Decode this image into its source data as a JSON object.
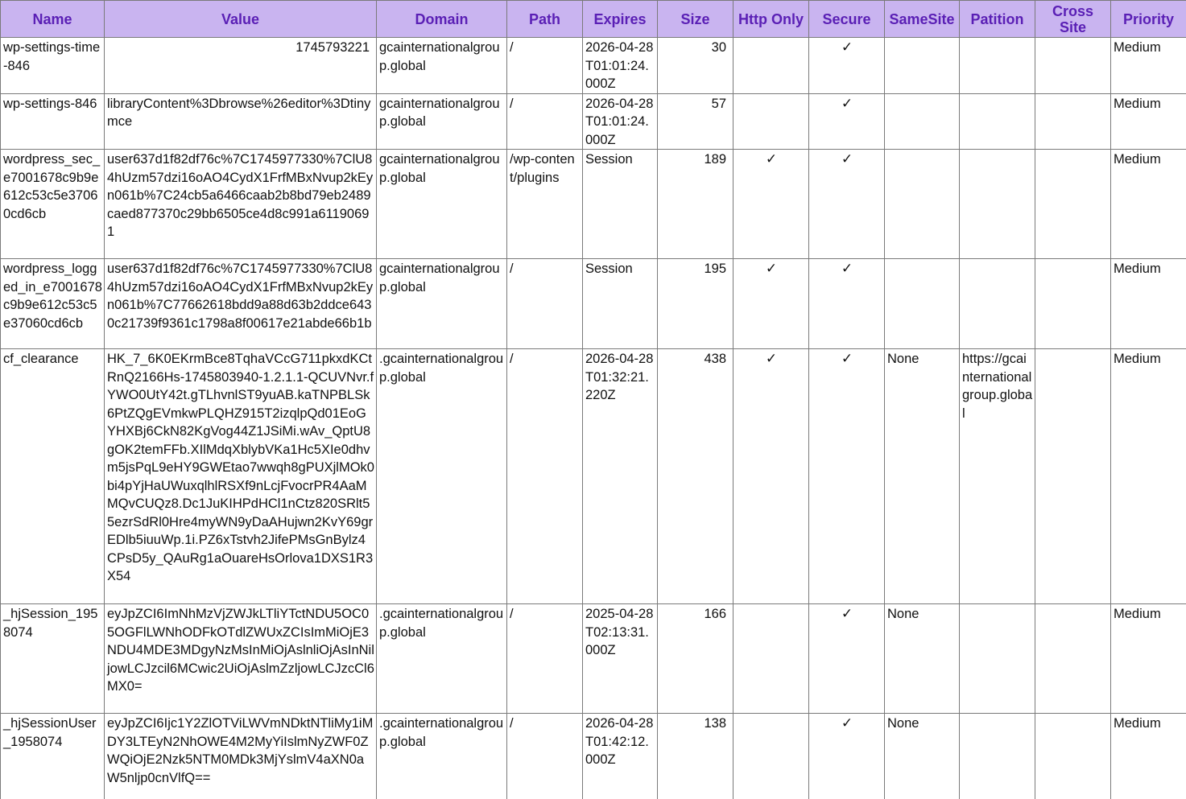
{
  "headers": {
    "name": "Name",
    "value": "Value",
    "domain": "Domain",
    "path": "Path",
    "expires": "Expires",
    "size": "Size",
    "http_only": "Http Only",
    "secure": "Secure",
    "same_site": "SameSite",
    "partition": "Patition",
    "cross_site": "Cross Site",
    "priority": "Priority"
  },
  "check_glyph": "✓",
  "colors": {
    "header_bg": "#c9b4f0",
    "header_text": "#5a1fb5",
    "grid": "#7a7a7a"
  },
  "rows": [
    {
      "name": "wp-settings-time-846",
      "value": "1745793221",
      "domain": "gcainternationalgroup.global",
      "path": "/",
      "expires": "2026-04-28T01:01:24.000Z",
      "size": "30",
      "http_only": "",
      "secure": "✓",
      "same_site": "",
      "partition": "",
      "cross_site": "",
      "priority": "Medium"
    },
    {
      "name": "wp-settings-846",
      "value": "libraryContent%3Dbrowse%26editor%3Dtinymce",
      "domain": "gcainternationalgroup.global",
      "path": "/",
      "expires": "2026-04-28T01:01:24.000Z",
      "size": "57",
      "http_only": "",
      "secure": "✓",
      "same_site": "",
      "partition": "",
      "cross_site": "",
      "priority": "Medium"
    },
    {
      "name": "wordpress_sec_e7001678c9b9e612c53c5e37060cd6cb",
      "value": "user637d1f82df76c%7C1745977330%7ClU84hUzm57dzi16oAO4CydX1FrfMBxNvup2kEyn061b%7C24cb5a6466caab2b8bd79eb2489caed877370c29bb6505ce4d8c991a61190691",
      "domain": "gcainternationalgroup.global",
      "path": "/wp-content/plugins",
      "expires": "Session",
      "size": "189",
      "http_only": "✓",
      "secure": "✓",
      "same_site": "",
      "partition": "",
      "cross_site": "",
      "priority": "Medium"
    },
    {
      "name": "wordpress_logged_in_e7001678c9b9e612c53c5e37060cd6cb",
      "value": "user637d1f82df76c%7C1745977330%7ClU84hUzm57dzi16oAO4CydX1FrfMBxNvup2kEyn061b%7C77662618bdd9a88d63b2ddce6430c21739f9361c1798a8f00617e21abde66b1b",
      "domain": "gcainternationalgroup.global",
      "path": "/",
      "expires": "Session",
      "size": "195",
      "http_only": "✓",
      "secure": "✓",
      "same_site": "",
      "partition": "",
      "cross_site": "",
      "priority": "Medium"
    },
    {
      "name": "cf_clearance",
      "value": "HK_7_6K0EKrmBce8TqhaVCcG711pkxdKCtRnQ2166Hs-1745803940-1.2.1.1-QCUVNvr.fYWO0UtY42t.gTLhvnlST9yuAB.kaTNPBLSk6PtZQgEVmkwPLQHZ915T2izqlpQd01EoGYHXBj6CkN82KgVog44Z1JSiMi.wAv_QptU8gOK2temFFb.XIlMdqXblybVKa1Hc5XIe0dhvm5jsPqL9eHY9GWEtao7wwqh8gPUXjlMOk0bi4pYjHaUWuxqlhlRSXf9nLcjFvocrPR4AaMMQvCUQz8.Dc1JuKIHPdHCl1nCtz820SRlt55ezrSdRl0Hre4myWN9yDaAHujwn2KvY69grEDlb5iuuWp.1i.PZ6xTstvh2JifePMsGnBylz4CPsD5y_QAuRg1aOuareHsOrlova1DXS1R3X54",
      "domain": ".gcainternationalgroup.global",
      "path": "/",
      "expires": "2026-04-28T01:32:21.220Z",
      "size": "438",
      "http_only": "✓",
      "secure": "✓",
      "same_site": "None",
      "partition": "https://gcainternationalgroup.global",
      "cross_site": "",
      "priority": "Medium"
    },
    {
      "name": "_hjSession_1958074",
      "value": "eyJpZCI6ImNhMzVjZWJkLTliYTctNDU5OC05OGFlLWNhODFkOTdlZWUxZCIsImMiOjE3NDU4MDE3MDgyNzMsInMiOjAslnliOjAsInNiljowLCJzcil6MCwic2UiOjAslmZzljowLCJzcCl6MX0=",
      "domain": ".gcainternationalgroup.global",
      "path": "/",
      "expires": "2025-04-28T02:13:31.000Z",
      "size": "166",
      "http_only": "",
      "secure": "✓",
      "same_site": "None",
      "partition": "",
      "cross_site": "",
      "priority": "Medium"
    },
    {
      "name": "_hjSessionUser_1958074",
      "value": "eyJpZCI6Ijc1Y2ZlOTViLWVmNDktNTliMy1iMDY3LTEyN2NhOWE4M2MyYiIslmNyZWF0ZWQiOjE2Nzk5NTM0MDk3MjYslmV4aXN0aW5nljp0cnVlfQ==",
      "domain": ".gcainternationalgroup.global",
      "path": "/",
      "expires": "2026-04-28T01:42:12.000Z",
      "size": "138",
      "http_only": "",
      "secure": "✓",
      "same_site": "None",
      "partition": "",
      "cross_site": "",
      "priority": "Medium"
    }
  ]
}
